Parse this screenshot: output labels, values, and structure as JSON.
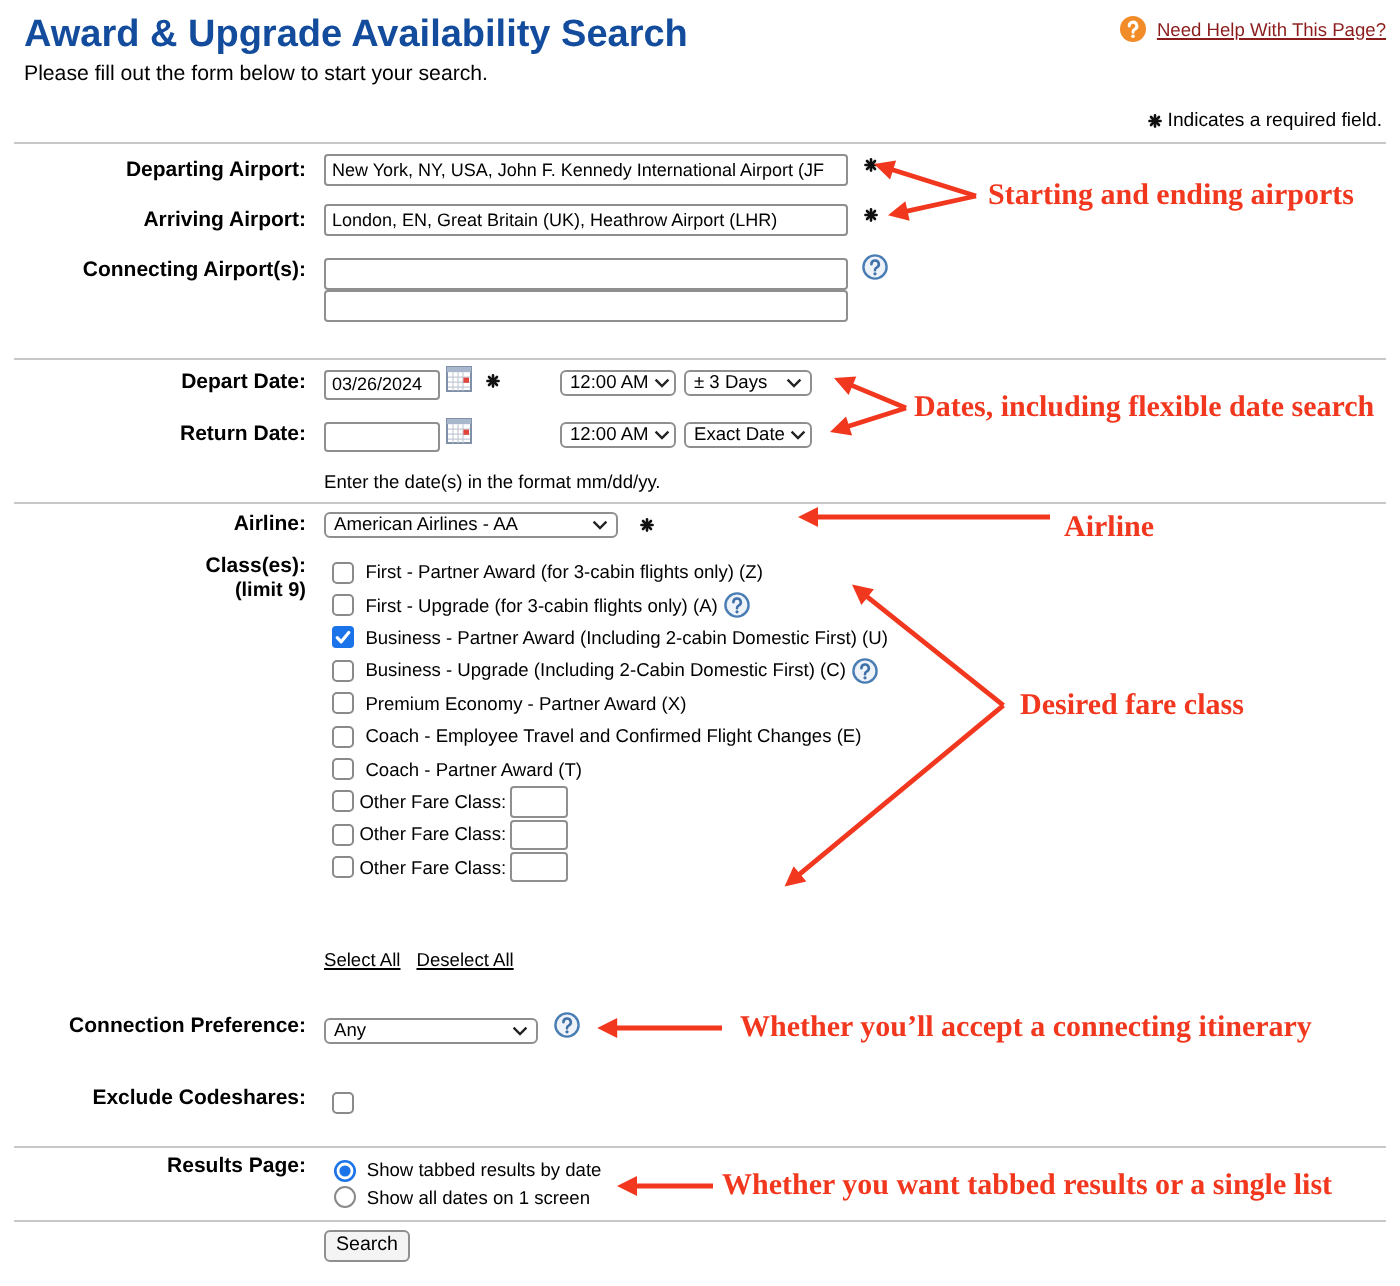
{
  "header": {
    "title": "Award & Upgrade Availability Search",
    "help_link": "Need Help With This Page?",
    "intro": "Please fill out the form below to start your search.",
    "required_note": "Indicates a required field."
  },
  "airports": {
    "departing": {
      "label": "Departing Airport:",
      "value": "New York, NY, USA, John F. Kennedy International Airport (JF",
      "required": true
    },
    "arriving": {
      "label": "Arriving Airport:",
      "value": "London, EN, Great Britain (UK), Heathrow Airport (LHR)",
      "required": true
    },
    "connecting": {
      "label": "Connecting Airport(s):",
      "required": false,
      "help": true
    }
  },
  "dates": {
    "depart": {
      "label": "Depart Date:",
      "value": "03/26/2024",
      "required": true,
      "time": "12:00 AM",
      "range": "± 3 Days"
    },
    "return": {
      "label": "Return Date:",
      "required": false,
      "time": "12:00 AM",
      "range": "Exact Date"
    },
    "hint": "Enter the date(s) in the format mm/dd/yy."
  },
  "airline": {
    "label": "Airline:",
    "value": "American Airlines - AA",
    "required": true
  },
  "classes": {
    "label": "Class(es):",
    "note": "(limit 9)",
    "options": [
      {
        "kind": "fixed",
        "label": "First - Partner Award (for 3-cabin flights only) (Z)",
        "checked": false,
        "help": false
      },
      {
        "kind": "fixed",
        "label": "First - Upgrade (for 3-cabin flights only) (A)",
        "checked": false,
        "help": true
      },
      {
        "kind": "fixed",
        "label": "Business - Partner Award (Including 2-cabin Domestic First) (U)",
        "checked": true,
        "help": false
      },
      {
        "kind": "fixed",
        "label": "Business - Upgrade (Including 2-Cabin Domestic First) (C)",
        "checked": false,
        "help": true
      },
      {
        "kind": "fixed",
        "label": "Premium Economy - Partner Award (X)",
        "checked": false,
        "help": false
      },
      {
        "kind": "fixed",
        "label": "Coach - Employee Travel and Confirmed Flight Changes (E)",
        "checked": false,
        "help": false
      },
      {
        "kind": "fixed",
        "label": "Coach - Partner Award (T)",
        "checked": false,
        "help": false
      },
      {
        "kind": "other",
        "label": "Other Fare Class:",
        "checked": false,
        "help": false
      },
      {
        "kind": "other",
        "label": "Other Fare Class:",
        "checked": false,
        "help": false
      },
      {
        "kind": "other",
        "label": "Other Fare Class:",
        "checked": false,
        "help": false
      }
    ],
    "select_all": "Select All",
    "deselect_all": "Deselect All"
  },
  "connection_preference": {
    "label": "Connection Preference:",
    "value": "Any",
    "help": true
  },
  "exclude_codeshares": {
    "label": "Exclude Codeshares:",
    "checked": false
  },
  "results_page": {
    "label": "Results Page:",
    "options": [
      {
        "label": "Show tabbed results by date",
        "selected": true
      },
      {
        "label": "Show all dates on 1 screen",
        "selected": false
      }
    ]
  },
  "search_button": "Search",
  "annotations": [
    "Starting and ending airports",
    "Dates, including flexible date search",
    "Airline",
    "Desired fare class",
    "Whether you’ll accept a connecting itinerary",
    "Whether you want tabbed results or a single list"
  ]
}
